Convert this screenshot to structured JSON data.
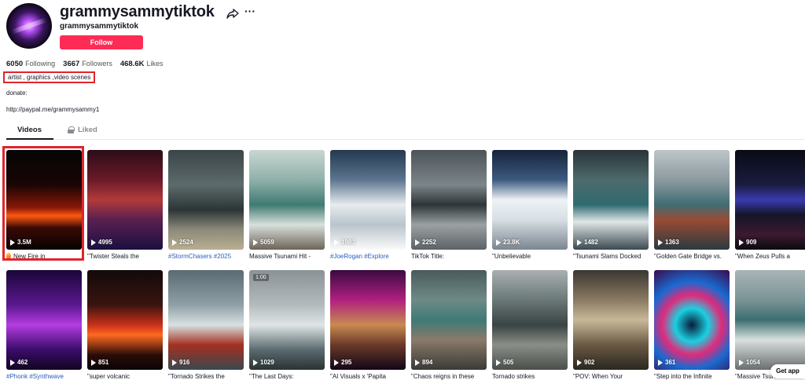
{
  "profile": {
    "username": "grammysammytiktok",
    "subname": "grammysammytiktok",
    "follow_label": "Follow",
    "stats": [
      {
        "value": "6050",
        "label": "Following"
      },
      {
        "value": "3667",
        "label": "Followers"
      },
      {
        "value": "468.6K",
        "label": "Likes"
      }
    ],
    "bio": "artist , graphics ,video scenes",
    "donate": "donate:",
    "link": "http://paypal.me/grammysammy1"
  },
  "tabs": {
    "videos": "Videos",
    "liked": "Liked"
  },
  "row1": [
    {
      "views": "3.5M",
      "caption": "New Fire in",
      "hot": true,
      "bg": "linear-gradient(180deg,#050505 0%,#1a0505 35%,#8a1808 58%,#ff5a10 66%,#3a0a05 78%,#060202 100%)"
    },
    {
      "views": "4995",
      "caption": "\"Twister Steals the",
      "bg": "linear-gradient(180deg,#2a0d18 0%,#6b1a28 30%,#b23a3a 50%,#5a2050 70%,#1a1040 100%)"
    },
    {
      "views": "2524",
      "caption": "#StormChasers #2025",
      "hashtag": true,
      "bg": "linear-gradient(180deg,#3a4548 0%,#5d6b6c 35%,#2b3536 60%,#8d8a7a 80%,#b8ae92 100%)"
    },
    {
      "views": "5059",
      "caption": "Massive Tsunami Hit -",
      "bg": "linear-gradient(180deg,#c9d6d2 0%,#8fb1aa 30%,#3f7a72 55%,#d9e0dc 75%,#6c6458 100%)"
    },
    {
      "views": "1983",
      "caption": "#JoeRogan #Explore",
      "hashtag": true,
      "bg": "linear-gradient(180deg,#24384f 0%,#5d7590 30%,#e6ecef 55%,#b9c4cc 75%,#fafafa 100%)"
    },
    {
      "views": "2252",
      "caption": "TikTok Title:",
      "bg": "linear-gradient(180deg,#4c5459 0%,#7c8589 35%,#2e3538 55%,#9aa1a3 75%,#5c6265 100%)"
    },
    {
      "views": "23.8K",
      "caption": "\"Unbelievable",
      "bg": "linear-gradient(180deg,#15233a 0%,#3c5a80 30%,#eef2f5 50%,#d8dfe4 70%,#7a8590 100%)"
    },
    {
      "views": "1482",
      "caption": "\"Tsunami Slams Docked",
      "bg": "linear-gradient(180deg,#2a3438 0%,#4d6a6c 30%,#2f6b70 55%,#e0e6e6 72%,#3a4a50 100%)"
    },
    {
      "views": "1363",
      "caption": "\"Golden Gate Bridge vs.",
      "bg": "linear-gradient(180deg,#bfc6c8 0%,#8c9aa0 30%,#406d74 55%,#9a4b33 70%,#2a3a40 100%)"
    },
    {
      "views": "909",
      "caption": "\"When Zeus Pulls a",
      "bg": "linear-gradient(180deg,#0a0a14 0%,#1a1c40 35%,#3a3ab0 50%,#151528 65%,#3a1a30 85%,#0a0a10 100%)"
    }
  ],
  "row2": [
    {
      "views": "462",
      "caption": "#Phonk #Synthwave",
      "hashtag": true,
      "bg": "linear-gradient(180deg,#1a0638 0%,#5a1890 35%,#b43ce0 55%,#3a0c6a 80%,#120420 100%)"
    },
    {
      "views": "851",
      "caption": "\"super volcanic",
      "bg": "linear-gradient(180deg,#120a0a 0%,#3a1410 35%,#c8301a 55%,#ff6a20 65%,#2a0c08 85%,#0a0505 100%)"
    },
    {
      "views": "916",
      "caption": "\"Tornado Strikes the",
      "bg": "linear-gradient(180deg,#5a6a72 0%,#8fa0a6 35%,#d8e0e2 55%,#a33020 75%,#3a4850 100%)"
    },
    {
      "views": "1029",
      "caption": "\"The Last Days:",
      "badge": "1:00",
      "bg": "linear-gradient(180deg,#8a9296 0%,#b3bbbd 35%,#dfe5e6 55%,#5a6a6e 80%,#2a3234 100%)"
    },
    {
      "views": "295",
      "caption": "\"AI Visuals x 'Papita",
      "bg": "linear-gradient(180deg,#3a0a40 0%,#b02080 30%,#c88a50 55%,#6a3a2a 75%,#120618 100%)"
    },
    {
      "views": "894",
      "caption": "\"Chaos reigns in these",
      "bg": "linear-gradient(180deg,#4a5a5c 0%,#6e8a86 30%,#3e7a76 50%,#8a7a6a 70%,#3a3a36 100%)"
    },
    {
      "views": "505",
      "caption": "Tornado strikes",
      "bg": "linear-gradient(180deg,#aab0b0 0%,#6a7878 30%,#3a4444 55%,#8a8e88 75%,#4a4e4a 100%)"
    },
    {
      "views": "902",
      "caption": "\"POV: When Your",
      "bg": "linear-gradient(180deg,#3a3632 0%,#8a7a62 30%,#c8b89a 50%,#6a5a44 75%,#2a2620 100%)"
    },
    {
      "views": "361",
      "caption": "\"Step into the Infinite",
      "bg": "radial-gradient(circle at 50% 55%,#0a1a3a 0%,#1ad0e0 25%,#e02a7a 45%,#1a6ad0 65%,#3a0a4a 100%)"
    },
    {
      "views": "1054",
      "caption": "\"Massive Tsunami",
      "bg": "linear-gradient(180deg,#aab4b6 0%,#7a9496 30%,#3c6e70 50%,#d9e0df 70%,#6a6e70 100%)"
    }
  ],
  "get_app_label": "Get app"
}
